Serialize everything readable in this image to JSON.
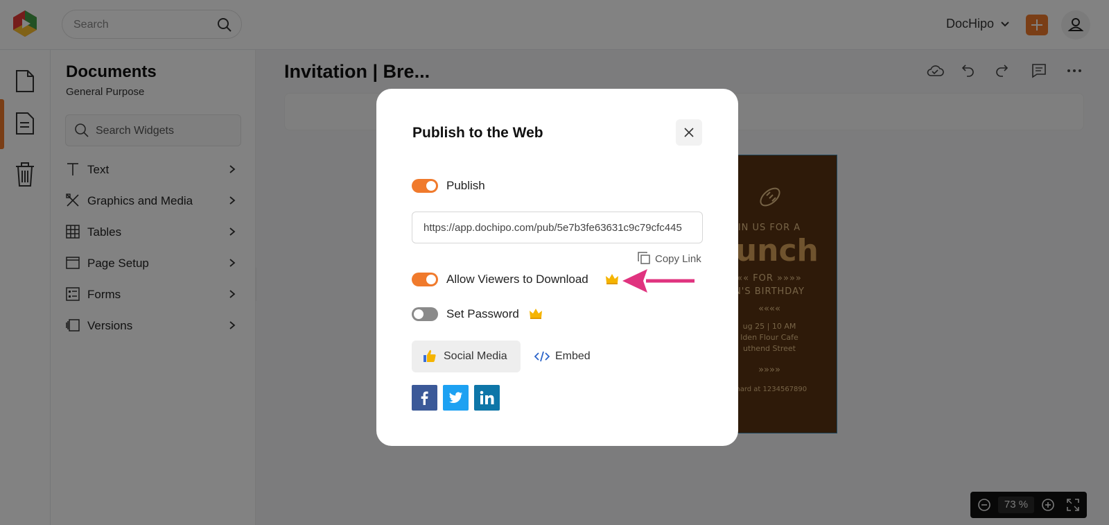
{
  "topbar": {
    "search_placeholder": "Search",
    "account_name": "DocHipo",
    "accent_color": "#f07a2c"
  },
  "rail": {
    "items": [
      {
        "icon": "document-icon"
      },
      {
        "icon": "widgets-document-icon"
      },
      {
        "icon": "trash-icon"
      }
    ]
  },
  "panel": {
    "title": "Documents",
    "subtitle": "General Purpose",
    "search_placeholder": "Search Widgets",
    "items": [
      {
        "label": "Text",
        "icon": "text-icon"
      },
      {
        "label": "Graphics and Media",
        "icon": "graphics-icon"
      },
      {
        "label": "Tables",
        "icon": "table-icon"
      },
      {
        "label": "Page Setup",
        "icon": "page-setup-icon"
      },
      {
        "label": "Forms",
        "icon": "forms-icon"
      },
      {
        "label": "Versions",
        "icon": "versions-icon"
      }
    ]
  },
  "canvas": {
    "doc_title": "Invitation | Bre...",
    "tools": [
      "cloud-save-icon",
      "undo-icon",
      "redo-icon",
      "comment-icon",
      "more-icon"
    ],
    "poster": {
      "line1": "IN US FOR A",
      "line2": "runch",
      "line3": "«« FOR »»»»",
      "line4": "N'S BIRTHDAY",
      "line5": "««««",
      "line6": "ug 25 | 10 AM",
      "line7": "lden Flour Cafe",
      "line8": "uthend Street",
      "line9": "»»»»",
      "line10": "chard at 1234567890"
    },
    "zoom": {
      "value": "73",
      "unit": "%"
    }
  },
  "modal": {
    "title": "Publish to the Web",
    "publish": {
      "label": "Publish",
      "on": true
    },
    "url": "https://app.dochipo.com/pub/5e7b3fe63631c9c79cfc445",
    "copy_link_label": "Copy Link",
    "allow_download": {
      "label": "Allow Viewers to Download",
      "on": true,
      "premium": true
    },
    "set_password": {
      "label": "Set Password",
      "on": false,
      "premium": true
    },
    "tabs": {
      "social": "Social Media",
      "embed": "Embed"
    },
    "share": [
      {
        "network": "facebook",
        "color": "#3b5998"
      },
      {
        "network": "twitter",
        "color": "#1da1f2"
      },
      {
        "network": "linkedin",
        "color": "#0e76a8"
      }
    ],
    "annotation_arrow_color": "#e0337f"
  }
}
